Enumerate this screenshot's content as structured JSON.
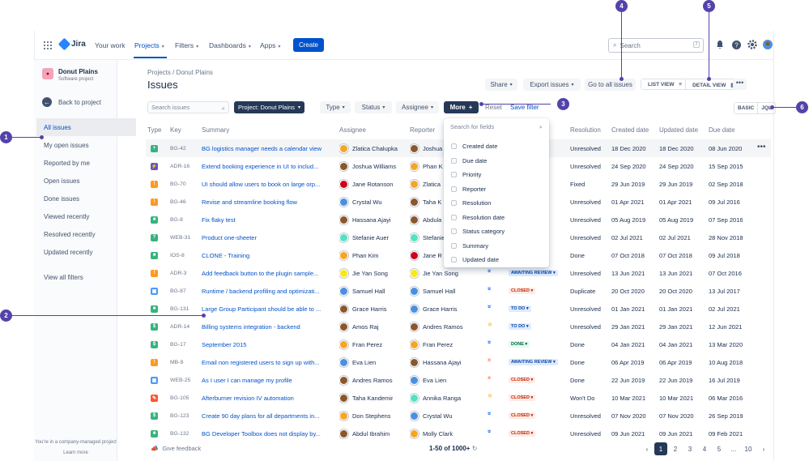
{
  "topnav": {
    "logo": "Jira",
    "items": [
      "Your work",
      "Projects",
      "Filters",
      "Dashboards",
      "Apps"
    ],
    "create": "Create",
    "search_placeholder": "Search",
    "search_key": "/"
  },
  "sidebar": {
    "project_name": "Donut Plains",
    "project_type": "Software project",
    "back": "Back to project",
    "items": [
      "All issues",
      "My open issues",
      "Reported by me",
      "Open issues",
      "Done issues",
      "Viewed recently",
      "Resolved recently",
      "Updated recently",
      "View all filters"
    ],
    "footer": "You're in a company-managed project",
    "footer_link": "Learn more"
  },
  "header": {
    "breadcrumb": "Projects / Donut Plains",
    "title": "Issues",
    "share": "Share",
    "export": "Export issues",
    "goto_all": "Go to all issues",
    "list_view": "LIST VIEW",
    "detail_view": "DETAIL VIEW",
    "more": "•••"
  },
  "filters": {
    "search_placeholder": "Search issues",
    "project": "Project: Donut Plains",
    "type": "Type",
    "status": "Status",
    "assignee": "Assignee",
    "more": "More",
    "reset": "Reset",
    "save": "Save filter",
    "basic": "BASIC",
    "jql": "JQL"
  },
  "columns": {
    "type": "Type",
    "key": "Key",
    "summary": "Summary",
    "assignee": "Assignee",
    "reporter": "Reporter",
    "resolution": "Resolution",
    "created": "Created date",
    "updated": "Updated date",
    "due": "Due date"
  },
  "dropdown": {
    "placeholder": "Search for fields",
    "items": [
      "Created date",
      "Due date",
      "Priority",
      "Reporter",
      "Resolution",
      "Resolution date",
      "Status category",
      "Summary",
      "Updated date"
    ]
  },
  "rows": [
    {
      "tcolor": "#36B37E",
      "tglyph": "+",
      "key": "BG-42",
      "summary": "BG logistics manager needs a calendar view",
      "assignee": "Zlatica Chalupka",
      "reporter": "Joshua",
      "prio": "",
      "status": "",
      "scolor": "",
      "sbg": "",
      "resolution": "Unresolved",
      "created": "18 Dec 2020",
      "updated": "18 Dec 2020",
      "due": "08 Jun 2020",
      "av1": "#F5A623",
      "av2": "#8B572A"
    },
    {
      "tcolor": "#6554C0",
      "tglyph": "⚡",
      "key": "ADR-16",
      "summary": "Extend booking experience in UI to includ...",
      "assignee": "Joshua Williams",
      "reporter": "Phan K",
      "prio": "",
      "status": "",
      "scolor": "",
      "sbg": "",
      "resolution": "Unresolved",
      "created": "24 Sep 2020",
      "updated": "24 Sep 2020",
      "due": "15 Sep 2015",
      "av1": "#8B572A",
      "av2": "#F5A623"
    },
    {
      "tcolor": "#FF991F",
      "tglyph": "!",
      "key": "BG-70",
      "summary": "UI should allow users to book on large orp...",
      "assignee": "Jane Rotanson",
      "reporter": "Zlatica",
      "prio": "",
      "status": "",
      "scolor": "",
      "sbg": "",
      "resolution": "Fixed",
      "created": "29 Jun 2019",
      "updated": "29 Jun 2019",
      "due": "02 Sep 2018",
      "av1": "#D0021B",
      "av2": "#F5A623"
    },
    {
      "tcolor": "#FF991F",
      "tglyph": "!",
      "key": "BG-46",
      "summary": "Revise and streamline booking flow",
      "assignee": "Crystal Wu",
      "reporter": "Taha K",
      "prio": "",
      "status": "",
      "scolor": "",
      "sbg": "",
      "resolution": "Unresolved",
      "created": "01 Apr 2021",
      "updated": "01 Apr 2021",
      "due": "09 Jul 2016",
      "av1": "#4A90E2",
      "av2": "#8B572A"
    },
    {
      "tcolor": "#36B37E",
      "tglyph": "■",
      "key": "BG-8",
      "summary": "Fix flaky test",
      "assignee": "Hassana Ajayi",
      "reporter": "Abdula",
      "prio": "",
      "status": "",
      "scolor": "",
      "sbg": "",
      "resolution": "Unresolved",
      "created": "05 Aug 2019",
      "updated": "05 Aug 2019",
      "due": "07 Sep 2016",
      "av1": "#8B572A",
      "av2": "#8B572A"
    },
    {
      "tcolor": "#36B37E",
      "tglyph": "?",
      "key": "WEB-31",
      "summary": "Product one-sheeter",
      "assignee": "Stefanie Auer",
      "reporter": "Stefanie",
      "prio": "",
      "status": "",
      "scolor": "",
      "sbg": "",
      "resolution": "Unresolved",
      "created": "02 Jul 2021",
      "updated": "02 Jul 2021",
      "due": "28 Nov 2018",
      "av1": "#50E3C2",
      "av2": "#50E3C2"
    },
    {
      "tcolor": "#36B37E",
      "tglyph": "■",
      "key": "IOS-8",
      "summary": "CLONE - Training",
      "assignee": "Phan Kim",
      "reporter": "Jane R",
      "prio": "",
      "status": "",
      "scolor": "",
      "sbg": "",
      "resolution": "Done",
      "created": "07 Oct 2018",
      "updated": "07 Oct 2018",
      "due": "09 Jul 2018",
      "av1": "#F5A623",
      "av2": "#D0021B"
    },
    {
      "tcolor": "#FF991F",
      "tglyph": "!",
      "key": "ADR-3",
      "summary": "Add feedback button to the plugin sample...",
      "assignee": "Jie Yan Song",
      "reporter": "Jie Yan Song",
      "prio": "»",
      "pcolor": "#0065FF",
      "status": "AWAITING REVIEW",
      "scolor": "#0747A6",
      "sbg": "#DEEBFF",
      "resolution": "Unresolved",
      "created": "13 Jun 2021",
      "updated": "13 Jun 2021",
      "due": "07 Oct 2016",
      "av1": "#F8E71C",
      "av2": "#F8E71C"
    },
    {
      "tcolor": "#4C9AFF",
      "tglyph": "▣",
      "key": "BG-87",
      "summary": "Runtime / backend profiling and optimizati...",
      "assignee": "Samuel Hall",
      "reporter": "Samuel Hall",
      "prio": "»",
      "pcolor": "#0065FF",
      "status": "CLOSED",
      "scolor": "#BF2600",
      "sbg": "#FFEBE6",
      "resolution": "Duplicate",
      "created": "20 Oct 2020",
      "updated": "20 Oct 2020",
      "due": "13 Jul 2017",
      "av1": "#4A90E2",
      "av2": "#4A90E2"
    },
    {
      "tcolor": "#36B37E",
      "tglyph": "■",
      "key": "BG-131",
      "summary": "Large Group Participant should be able to ...",
      "assignee": "Grace Harris",
      "reporter": "Grace Harris",
      "prio": "»",
      "pcolor": "#0065FF",
      "status": "TO DO",
      "scolor": "#0747A6",
      "sbg": "#DEEBFF",
      "resolution": "Unresolved",
      "created": "01 Jan 2021",
      "updated": "01 Jan 2021",
      "due": "02 Jul 2021",
      "av1": "#8B572A",
      "av2": "#4A90E2"
    },
    {
      "tcolor": "#36B37E",
      "tglyph": "$",
      "key": "ADR-14",
      "summary": "Billing systems integration - backend",
      "assignee": "Amos Raj",
      "reporter": "Andres Ramos",
      "prio": "=",
      "pcolor": "#FFAB00",
      "status": "TO DO",
      "scolor": "#0747A6",
      "sbg": "#DEEBFF",
      "resolution": "Unresolved",
      "created": "29 Jan 2021",
      "updated": "29 Jan 2021",
      "due": "12 Jun 2021",
      "av1": "#8B572A",
      "av2": "#8B572A"
    },
    {
      "tcolor": "#36B37E",
      "tglyph": "$",
      "key": "BG-17",
      "summary": "September 2015",
      "assignee": "Fran Perez",
      "reporter": "Fran Perez",
      "prio": "»",
      "pcolor": "#0065FF",
      "status": "DONE",
      "scolor": "#006644",
      "sbg": "#E3FCEF",
      "resolution": "Done",
      "created": "04 Jan 2021",
      "updated": "04 Jan 2021",
      "due": "13 Mar 2020",
      "av1": "#F5A623",
      "av2": "#F5A623"
    },
    {
      "tcolor": "#FF991F",
      "tglyph": "!",
      "key": "MB-9",
      "summary": "Email non registered users to sign up with...",
      "assignee": "Eva Lien",
      "reporter": "Hassana Ajayi",
      "prio": "«",
      "pcolor": "#FF7452",
      "status": "AWAITING REVIEW",
      "scolor": "#0747A6",
      "sbg": "#DEEBFF",
      "resolution": "Done",
      "created": "06 Apr 2019",
      "updated": "06 Apr 2019",
      "due": "10 Aug 2018",
      "av1": "#4A90E2",
      "av2": "#8B572A"
    },
    {
      "tcolor": "#4C9AFF",
      "tglyph": "▣",
      "key": "WEB-25",
      "summary": "As I user I can manage my profile",
      "assignee": "Andres Ramos",
      "reporter": "Eva Lien",
      "prio": "«",
      "pcolor": "#FF7452",
      "status": "CLOSED",
      "scolor": "#BF2600",
      "sbg": "#FFEBE6",
      "resolution": "Done",
      "created": "22 Jun 2019",
      "updated": "22 Jun 2019",
      "due": "16 Jul 2019",
      "av1": "#8B572A",
      "av2": "#4A90E2"
    },
    {
      "tcolor": "#FF5630",
      "tglyph": "✎",
      "key": "BG-105",
      "summary": "Afterburner revision IV automation",
      "assignee": "Taha Kandemir",
      "reporter": "Annika Ranga",
      "prio": "=",
      "pcolor": "#FFAB00",
      "status": "CLOSED",
      "scolor": "#BF2600",
      "sbg": "#FFEBE6",
      "resolution": "Won't Do",
      "created": "10 Mar 2021",
      "updated": "10 Mar 2021",
      "due": "06 Mar 2016",
      "av1": "#8B572A",
      "av2": "#50E3C2"
    },
    {
      "tcolor": "#36B37E",
      "tglyph": "$",
      "key": "BG-123",
      "summary": "Create 90 day plans for all departments in...",
      "assignee": "Don Stephens",
      "reporter": "Crystal Wu",
      "prio": "»",
      "pcolor": "#0065FF",
      "status": "CLOSED",
      "scolor": "#BF2600",
      "sbg": "#FFEBE6",
      "resolution": "Unresolved",
      "created": "07 Nov 2020",
      "updated": "07 Nov 2020",
      "due": "26 Sep 2019",
      "av1": "#F5A623",
      "av2": "#4A90E2"
    },
    {
      "tcolor": "#36B37E",
      "tglyph": "■",
      "key": "BG-132",
      "summary": "BG Developer Toolbox does not display by...",
      "assignee": "Abdul Ibrahim",
      "reporter": "Molly Clark",
      "prio": "»",
      "pcolor": "#0065FF",
      "status": "CLOSED",
      "scolor": "#BF2600",
      "sbg": "#FFEBE6",
      "resolution": "Unresolved",
      "created": "09 Jun 2021",
      "updated": "09 Jun 2021",
      "due": "09 Feb 2021",
      "av1": "#8B572A",
      "av2": "#F5A623"
    }
  ],
  "footer": {
    "feedback": "Give feedback",
    "count": "1-50 of 1000+",
    "pages": [
      "1",
      "2",
      "3",
      "4",
      "5",
      "...",
      "10"
    ]
  },
  "callouts": [
    "1",
    "2",
    "3",
    "4",
    "5",
    "6"
  ],
  "colors": {
    "primary": "#0052CC",
    "callout": "#5243AA",
    "dark": "#253858"
  }
}
